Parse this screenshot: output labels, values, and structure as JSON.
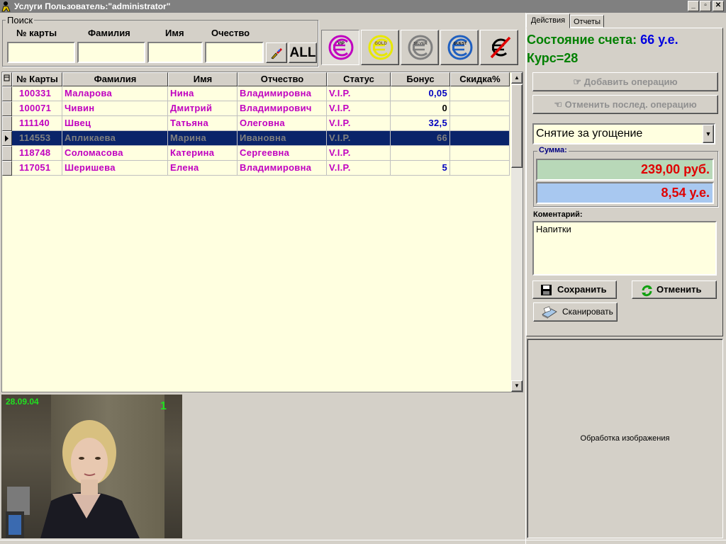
{
  "window": {
    "title": "Услуги Пользователь:\"administrator\"",
    "min": "_",
    "max": "▫",
    "close": "✕"
  },
  "search": {
    "group_label": "Поиск",
    "card_label": "№ карты",
    "surname_label": "Фамилия",
    "name_label": "Имя",
    "patronymic_label": "Очество",
    "card_value": "",
    "surname_value": "",
    "name_value": "",
    "patronymic_value": "",
    "all_label": "ALL"
  },
  "statuses": [
    {
      "label": "VIP",
      "color": "#c000c0"
    },
    {
      "label": "GOLD",
      "color": "#e0e000"
    },
    {
      "label": "SILVER",
      "color": "#808080"
    },
    {
      "label": "GUEST",
      "color": "#2060c0"
    },
    {
      "label": "",
      "color": "#e00000"
    }
  ],
  "grid": {
    "headers": [
      "№ Карты",
      "Фамилия",
      "Имя",
      "Отчество",
      "Статус",
      "Бонус",
      "Скидка%"
    ],
    "rows": [
      {
        "card": "100331",
        "surname": "Маларова",
        "name": "Нина",
        "patronymic": "Владимировна",
        "status": "V.I.P.",
        "bonus": "0,05",
        "discount": ""
      },
      {
        "card": "100071",
        "surname": "Чивин",
        "name": "Дмитрий",
        "patronymic": "Владимирович",
        "status": "V.I.P.",
        "bonus": "0",
        "discount": ""
      },
      {
        "card": "111140",
        "surname": "Швец",
        "name": "Татьяна",
        "patronymic": "Олеговна",
        "status": "V.I.P.",
        "bonus": "32,5",
        "discount": ""
      },
      {
        "card": "114553",
        "surname": "Апликаева",
        "name": "Марина",
        "patronymic": "Ивановна",
        "status": "V.I.P.",
        "bonus": "66",
        "discount": ""
      },
      {
        "card": "118748",
        "surname": "Соломасова",
        "name": "Катерина",
        "patronymic": "Сергеевна",
        "status": "V.I.P.",
        "bonus": "",
        "discount": ""
      },
      {
        "card": "117051",
        "surname": "Шеришева",
        "name": "Елена",
        "patronymic": "Владимировна",
        "status": "V.I.P.",
        "bonus": "5",
        "discount": ""
      }
    ],
    "selected_row": 3,
    "colors": {
      "text": "#c000c0",
      "bonus": "#0000c0",
      "selected_bg": "#0a246a",
      "selected_text": "#808080",
      "row_bg": "#ffffe0"
    }
  },
  "camera": {
    "date": "28.09.04",
    "number": "1"
  },
  "tabs": [
    "Действия",
    "Отчеты"
  ],
  "account": {
    "state_label": "Состояние счета:",
    "state_value": "66 у.е.",
    "rate": "Курс=28",
    "label_color": "#008000",
    "value_color": "#0000e0"
  },
  "actions": {
    "add_label": "Добавить операцию",
    "cancel_last_label": "Отменить послед. операцию"
  },
  "operation": {
    "selected": "Снятие за угощение"
  },
  "sum": {
    "label": "Сумма:",
    "rub": "239,00 руб.",
    "ue": "8,54 у.е.",
    "rub_bg": "#b8d8b8",
    "ue_bg": "#a8c8f0",
    "value_color": "#e00000"
  },
  "comment": {
    "label": "Коментарий:",
    "value": "Напитки"
  },
  "buttons": {
    "save": "Сохранить",
    "cancel": "Отменить",
    "scan": "Сканировать"
  },
  "image_panel": {
    "label": "Обработка изображения"
  }
}
